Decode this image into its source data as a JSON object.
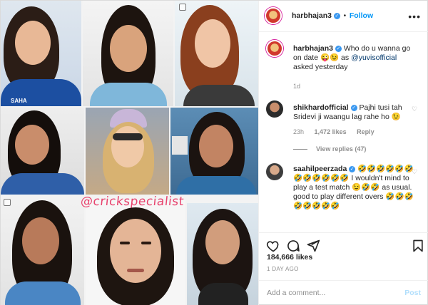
{
  "media": {
    "watermark": "@crickspecialist"
  },
  "header": {
    "username": "harbhajan3",
    "verified_icon": "verified-badge-icon",
    "separator": "•",
    "follow_label": "Follow",
    "more_icon": "more-options-icon"
  },
  "caption": {
    "username": "harbhajan3",
    "text_before": "Who do u wanna go on date",
    "emoji": "😜😉",
    "text_mid": " as ",
    "mention": "@yuvisofficial",
    "text_after": " asked yesterday",
    "age": "1d"
  },
  "comments": [
    {
      "username": "shikhardofficial",
      "text": "Pajhi tusi tah Sridevi ji waangu lag rahe ho 😉",
      "age": "23h",
      "likes": "1,472 likes",
      "reply_label": "Reply",
      "view_replies": "View replies (47)"
    },
    {
      "username": "saahilpeerzada",
      "text_part1": "🤣🤣🤣🤣🤣🤣🤣🤣🤣🤣🤣🤣 I wouldn't mind to play a test match 😉🤣🤣 as usual. good to play different overs 🤣🤣🤣🤣🤣🤣🤣🤣"
    }
  ],
  "actions": {
    "like_icon": "heart-icon",
    "comment_icon": "comment-icon",
    "share_icon": "share-icon",
    "save_icon": "bookmark-icon",
    "likes": "184,666 likes",
    "timestamp": "1 DAY AGO"
  },
  "add_comment": {
    "placeholder": "Add a comment...",
    "post_label": "Post"
  }
}
